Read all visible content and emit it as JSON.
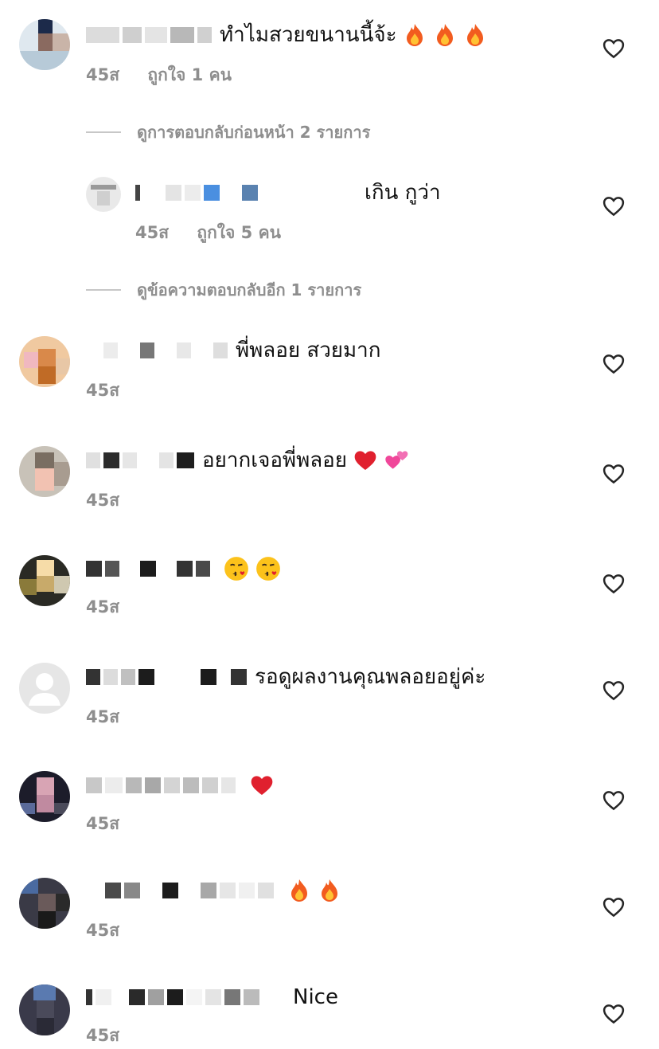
{
  "comments": [
    {
      "text": "ทำไมสวยขนานนี้จ้ะ",
      "emojis": [
        "fire-emoji",
        "fire-emoji",
        "fire-emoji"
      ],
      "time": "45ส",
      "likes": "ถูกใจ 1 คน"
    },
    {
      "text": "เกิน กูว่า",
      "emojis": [],
      "time": "45ส",
      "likes": "ถูกใจ 5 คน"
    },
    {
      "text": "พี่พลอย สวยมาก",
      "emojis": [],
      "time": "45ส",
      "likes": ""
    },
    {
      "text": "อยากเจอพี่พลอย",
      "emojis": [
        "red-heart-emoji",
        "two-hearts-emoji"
      ],
      "time": "45ส",
      "likes": ""
    },
    {
      "text": "",
      "emojis": [
        "kissing-face-emoji",
        "kissing-face-emoji"
      ],
      "time": "45ส",
      "likes": ""
    },
    {
      "text": "รอดูผลงานคุณพลอยอยู่ค่ะ",
      "emojis": [],
      "time": "45ส",
      "likes": ""
    },
    {
      "text": "",
      "emojis": [
        "red-heart-emoji"
      ],
      "time": "45ส",
      "likes": ""
    },
    {
      "text": "",
      "emojis": [
        "fire-emoji",
        "fire-emoji"
      ],
      "time": "45ส",
      "likes": ""
    },
    {
      "text": "Nice",
      "emojis": [],
      "time": "45ส",
      "likes": ""
    }
  ],
  "threads": {
    "previous_replies": "ดูการตอบกลับก่อนหน้า 2 รายการ",
    "more_replies": "ดูข้อความตอบกลับอีก 1 รายการ"
  },
  "colors": {
    "meta_gray": "#8e8e8e",
    "heart_outline": "#262626",
    "redact_dark": "#333333",
    "redact_light": "#e6e6e6"
  },
  "icons": {
    "like": "heart-outline-icon",
    "avatar_placeholder": "default-user-icon"
  }
}
